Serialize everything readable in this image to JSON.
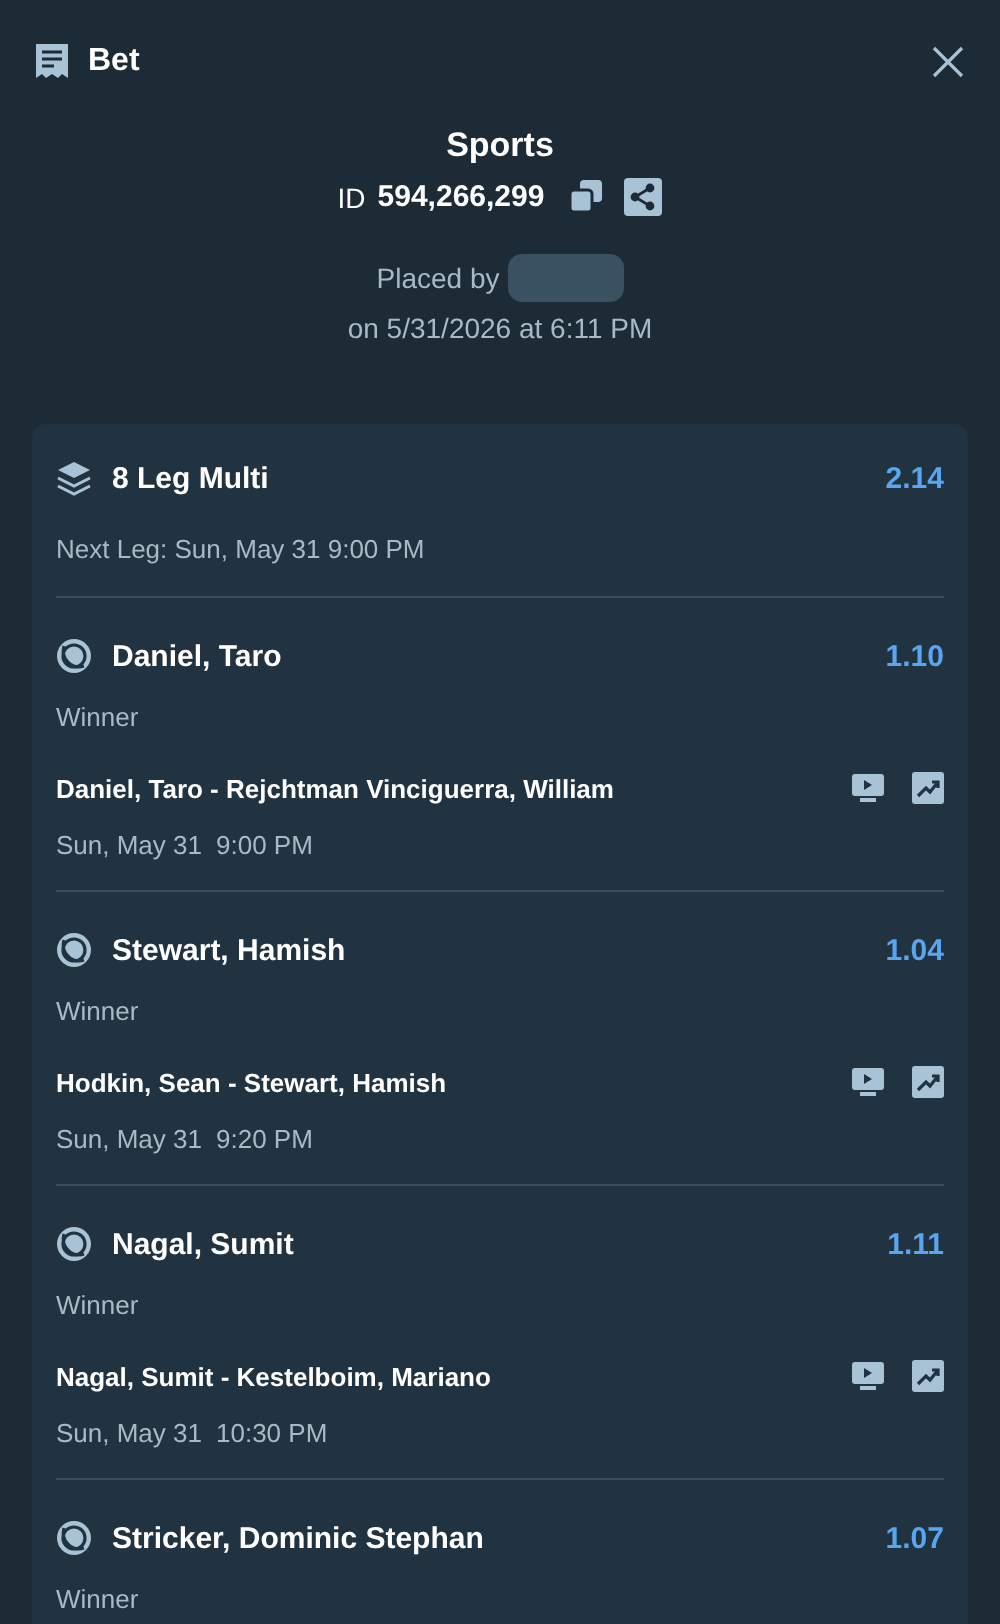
{
  "header": {
    "title": "Bet"
  },
  "summary": {
    "category": "Sports",
    "id_label": "ID",
    "id_value": "594,266,299",
    "placed_by_label": "Placed by",
    "placed_on": "on 5/31/2026 at 6:11 PM"
  },
  "multi": {
    "title": "8 Leg Multi",
    "odds": "2.14",
    "next_leg": "Next Leg: Sun, May 31 9:00 PM"
  },
  "legs": [
    {
      "selection": "Daniel, Taro",
      "odds": "1.10",
      "market": "Winner",
      "event": "Daniel, Taro - Rejchtman Vinciguerra, William",
      "date": "Sun, May 31",
      "time": "9:00 PM"
    },
    {
      "selection": "Stewart, Hamish",
      "odds": "1.04",
      "market": "Winner",
      "event": "Hodkin, Sean - Stewart, Hamish",
      "date": "Sun, May 31",
      "time": "9:20 PM"
    },
    {
      "selection": "Nagal, Sumit",
      "odds": "1.11",
      "market": "Winner",
      "event": "Nagal, Sumit - Kestelboim, Mariano",
      "date": "Sun, May 31",
      "time": "10:30 PM"
    },
    {
      "selection": "Stricker, Dominic Stephan",
      "odds": "1.07",
      "market": "Winner"
    }
  ]
}
